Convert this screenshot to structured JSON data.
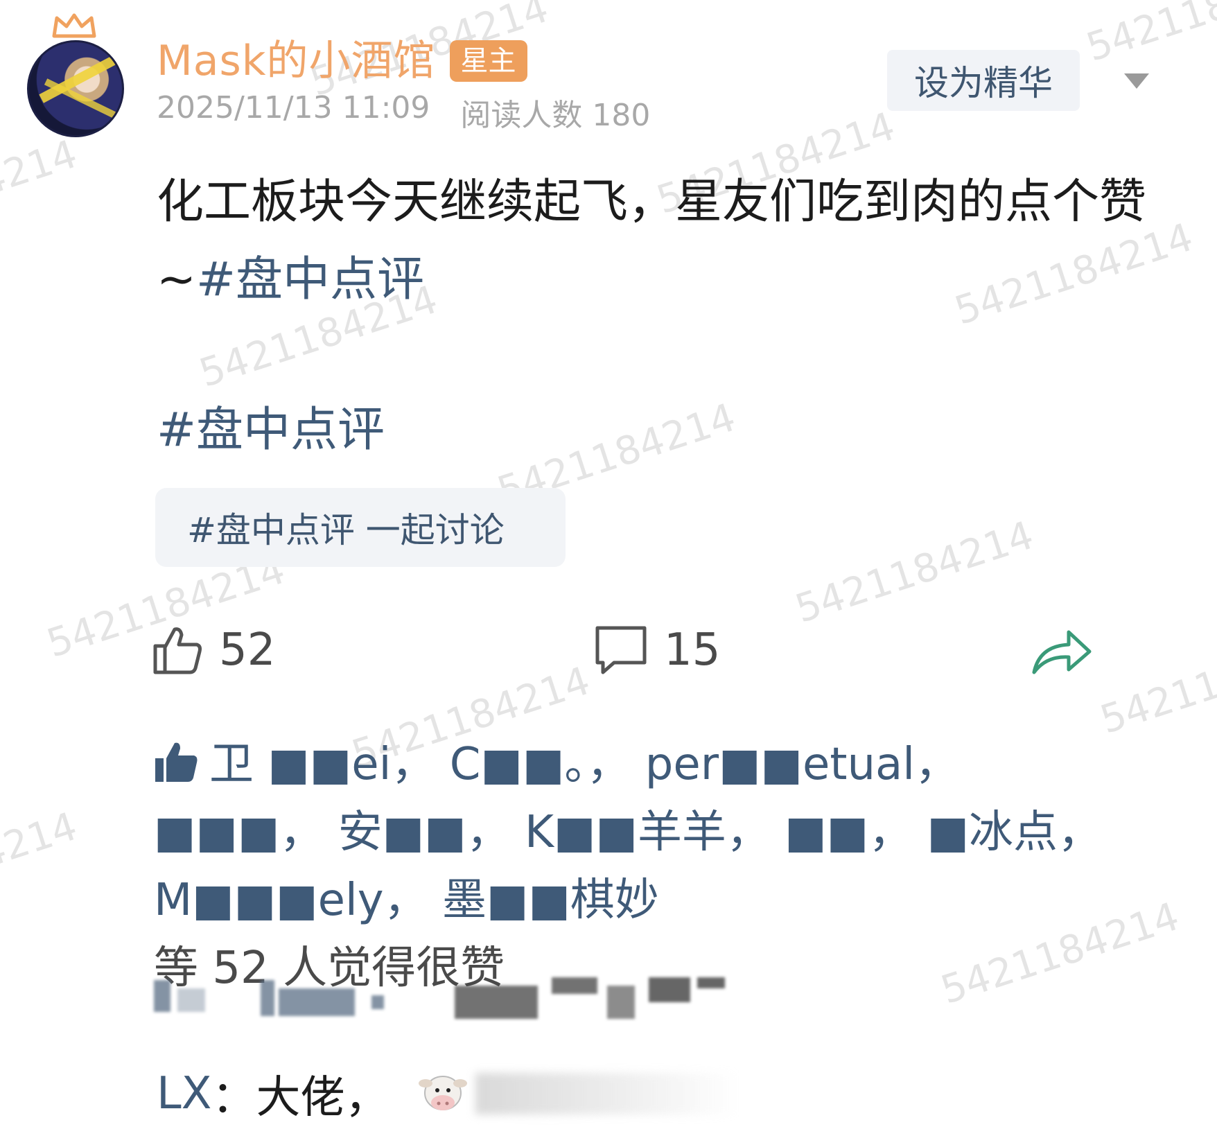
{
  "watermark_text": "5421184214",
  "author": {
    "name": "Mask的小酒馆",
    "badge": "星主"
  },
  "meta": {
    "timestamp": "2025/11/13 11:09",
    "read_count": "阅读人数 180"
  },
  "toolbar": {
    "essence_label": "设为精华"
  },
  "post": {
    "text": "化工板块今天继续起飞，星友们吃到肉的点个赞 ~",
    "inline_hashtag": "#盘中点评",
    "topic_hashtag": "#盘中点评",
    "topic_chip": "#盘中点评 一起讨论"
  },
  "stats": {
    "likes": "52",
    "comments": "15"
  },
  "likers": {
    "names": [
      "卫 ■■ei",
      "C■■。",
      "per■■etual",
      "■■■",
      "安■■",
      "K■■羊羊",
      "■■",
      "■冰点",
      "M■■■ely",
      "墨■■棋妙"
    ],
    "separator": "，",
    "summary": "等 52 人觉得很赞"
  },
  "comment_preview": {
    "user": "LX",
    "colon": "：",
    "text": "大佬，"
  },
  "colors": {
    "accent_orange": "#f0a56a",
    "badge_orange": "#ee9f5c",
    "link_blue": "#3f5a78",
    "share_green": "#3a9a78"
  },
  "icons": {
    "like": "thumbs-up-outline-icon",
    "comment": "comment-bubble-icon",
    "share": "share-arrow-icon",
    "liked": "thumbs-up-filled-icon",
    "dropdown": "chevron-down-icon"
  }
}
